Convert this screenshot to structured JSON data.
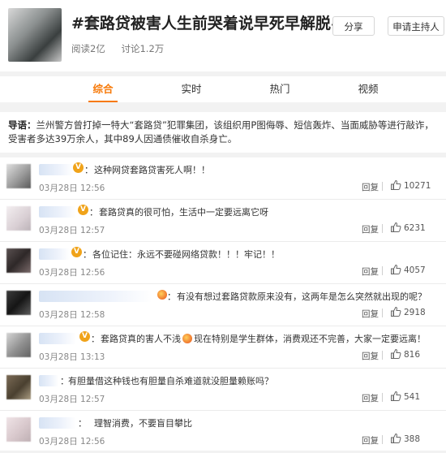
{
  "topic": {
    "title": "#套路贷被害人生前哭着说早死早解脱#",
    "reads": "阅读2亿",
    "discussions": "讨论1.2万",
    "share_label": "分享",
    "host_label": "申请主持人"
  },
  "tabs": [
    "综合",
    "实时",
    "热门",
    "视频"
  ],
  "active_tab": "综合",
  "guide": {
    "label": "导语：",
    "text": "兰州警方曾打掉一特大“套路贷”犯罪集团，该组织用P图侮辱、短信轰炸、当面威胁等进行敲诈，受害者多达39万余人，其中89人因通债催收自杀身亡。"
  },
  "comments": [
    {
      "text": "这种网贷套路贷害死人啊！！",
      "time": "03月28日 12:56",
      "reply": "回复",
      "likes": "10271"
    },
    {
      "text": "套路贷真的很可怕，生活中一定要远离它呀",
      "time": "03月28日 12:57",
      "reply": "回复",
      "likes": "6231"
    },
    {
      "text": "各位记住：永远不要碰网络贷款！！！牢记！！",
      "time": "03月28日 12:56",
      "reply": "回复",
      "likes": "4057"
    },
    {
      "text": "有没有想过套路贷款原来没有，这两年是怎么突然就出现的呢？",
      "time": "03月28日 12:58",
      "reply": "回复",
      "likes": "2918"
    },
    {
      "text_before": "套路贷真的害人不浅",
      "text_after": "现在特别是学生群体，消费观还不完善，大家一定要远离！",
      "time": "03月28日 13:13",
      "reply": "回复",
      "likes": "816"
    },
    {
      "text": "有胆量借这种钱也有胆量自杀难道就没胆量赖账吗？",
      "time": "03月28日 12:57",
      "reply": "回复",
      "likes": "541"
    },
    {
      "text": "理智消费，不要盲目攀比",
      "time": "03月28日 12:56",
      "reply": "回复",
      "likes": "388"
    }
  ],
  "colors": {
    "accent": "#f77a0a",
    "verified_badge": "#f0a31a"
  },
  "icons": {
    "like": "thumbs-up-icon",
    "verified": "verified-v-icon"
  }
}
